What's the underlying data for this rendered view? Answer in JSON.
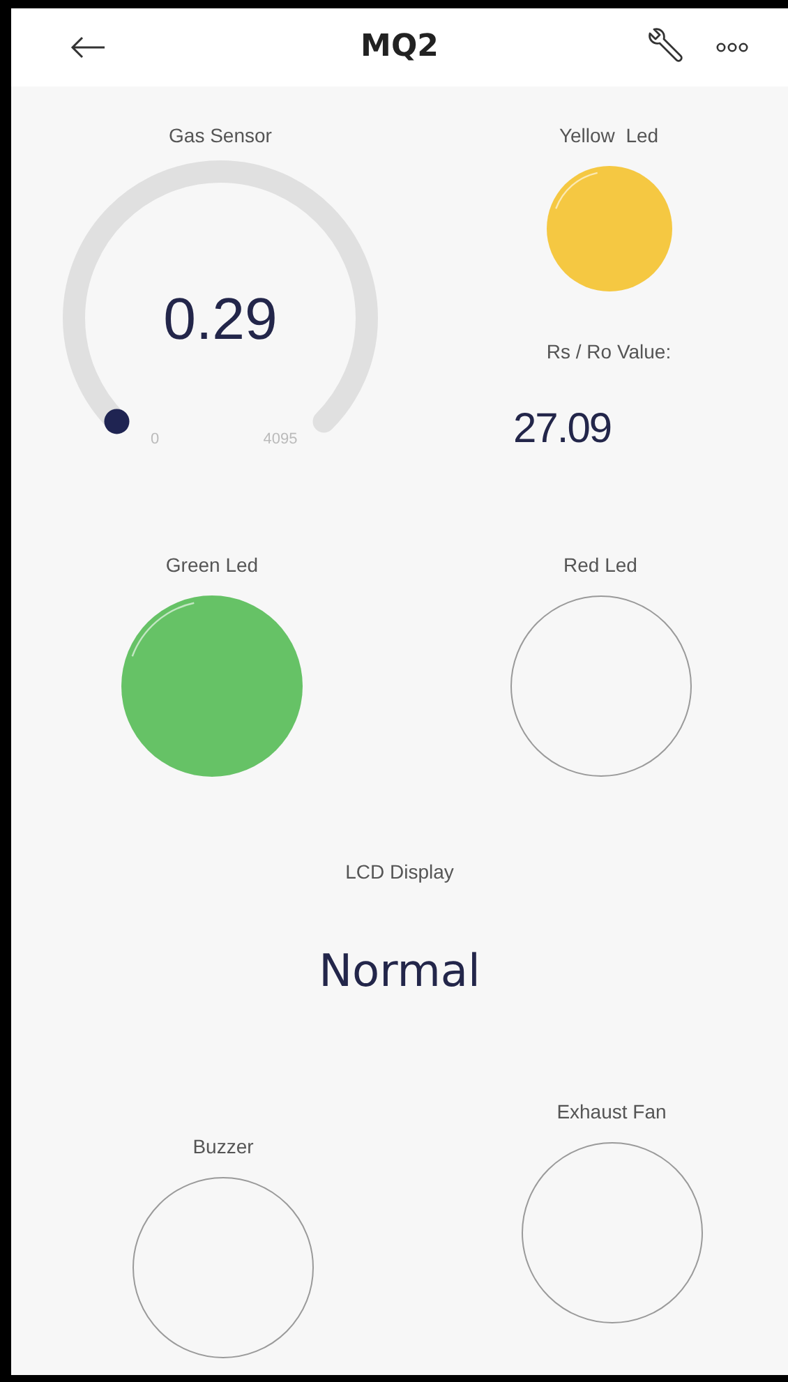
{
  "header": {
    "title": "MQ2"
  },
  "widgets": [
    {
      "kind": "gauge",
      "label": "Gas Sensor",
      "value": "0.29",
      "min": "0",
      "max": "4095"
    },
    {
      "kind": "led",
      "label": "Yellow  Led",
      "on": true,
      "color": "#f5c842"
    },
    {
      "kind": "value",
      "label": "Rs / Ro Value:",
      "value": "27.09"
    },
    {
      "kind": "led",
      "label": "Green Led",
      "on": true,
      "color": "#66c266"
    },
    {
      "kind": "led",
      "label": "Red Led",
      "on": false
    },
    {
      "kind": "lcd",
      "label": "LCD Display",
      "value": "Normal"
    },
    {
      "kind": "led",
      "label": "Buzzer",
      "on": false
    },
    {
      "kind": "led",
      "label": "Exhaust Fan",
      "on": false
    }
  ]
}
